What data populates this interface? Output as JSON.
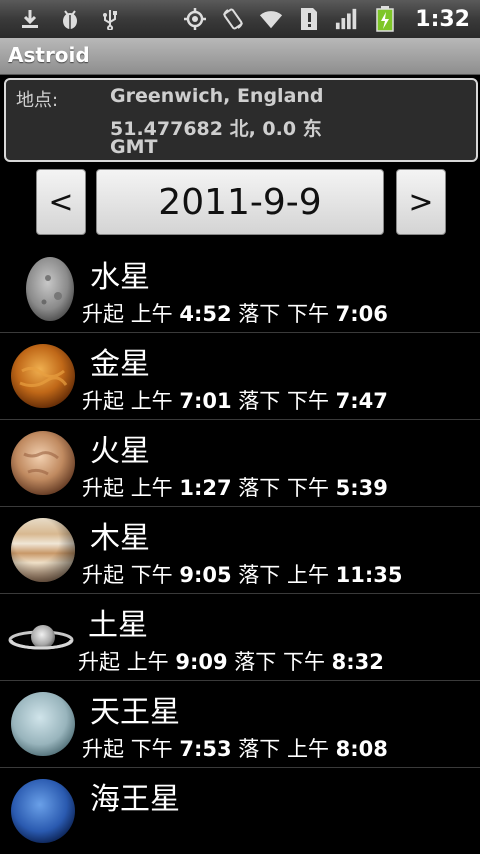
{
  "status_bar": {
    "time": "1:32",
    "icons": [
      "download-icon",
      "debug-icon",
      "usb-icon",
      "gps-icon",
      "rotate-icon",
      "wifi-icon",
      "alert-icon",
      "signal-icon",
      "battery-charging-icon"
    ]
  },
  "app": {
    "title": "Astroid"
  },
  "location": {
    "label": "地点:",
    "place": "Greenwich, England",
    "coords": "51.477682 北, 0.0 东",
    "timezone": "GMT"
  },
  "date_nav": {
    "prev_label": "<",
    "date": "2011-9-9",
    "next_label": ">"
  },
  "planets": [
    {
      "name": "水星",
      "rise_label": "升起",
      "rise_period": "上午",
      "rise_time": "4:52",
      "set_label": "落下",
      "set_period": "下午",
      "set_time": "7:06"
    },
    {
      "name": "金星",
      "rise_label": "升起",
      "rise_period": "上午",
      "rise_time": "7:01",
      "set_label": "落下",
      "set_period": "下午",
      "set_time": "7:47"
    },
    {
      "name": "火星",
      "rise_label": "升起",
      "rise_period": "上午",
      "rise_time": "1:27",
      "set_label": "落下",
      "set_period": "下午",
      "set_time": "5:39"
    },
    {
      "name": "木星",
      "rise_label": "升起",
      "rise_period": "下午",
      "rise_time": "9:05",
      "set_label": "落下",
      "set_period": "上午",
      "set_time": "11:35"
    },
    {
      "name": "土星",
      "rise_label": "升起",
      "rise_period": "上午",
      "rise_time": "9:09",
      "set_label": "落下",
      "set_period": "下午",
      "set_time": "8:32"
    },
    {
      "name": "天王星",
      "rise_label": "升起",
      "rise_period": "下午",
      "rise_time": "7:53",
      "set_label": "落下",
      "set_period": "上午",
      "set_time": "8:08"
    },
    {
      "name": "海王星"
    }
  ]
}
